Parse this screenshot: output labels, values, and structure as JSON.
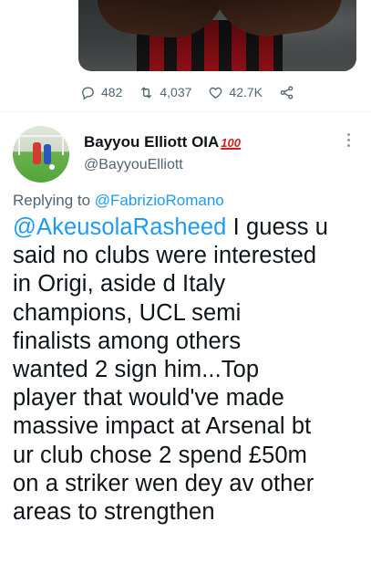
{
  "tweet_actions": {
    "replies": "482",
    "retweets": "4,037",
    "likes": "42.7K"
  },
  "reply": {
    "author_name": "Bayyou Elliott OIA",
    "author_badge": "100",
    "author_handle": "@BayyouElliott",
    "replying_prefix": "Replying to ",
    "replying_to": "@FabrizioRomano",
    "mention": "@AkeusolaRasheed",
    "body_lines": [
      " I guess u",
      "said no clubs were interested",
      "in Origi, aside d Italy",
      "champions, UCL semi",
      "finalists among others",
      "wanted 2 sign him...Top",
      "player that would've made",
      "massive impact at Arsenal bt",
      "ur club chose 2 spend £50m",
      "on a striker wen dey av other",
      "areas to strengthen"
    ]
  },
  "colors": {
    "link": "#1d9bf0",
    "secondary_text": "#536471",
    "primary_text": "#0f1419"
  },
  "icons": [
    "reply-icon",
    "retweet-icon",
    "like-icon",
    "share-icon",
    "more-options-icon"
  ]
}
